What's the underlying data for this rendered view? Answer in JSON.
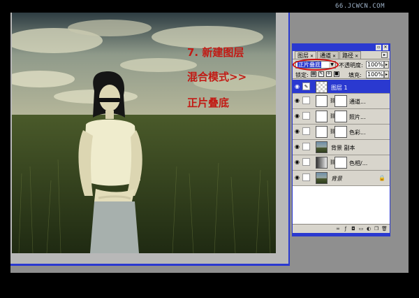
{
  "watermark": "66.JCWCN.COM",
  "annotations": {
    "step": "7. 新建图层",
    "blend_mode": "混合模式>>",
    "multiply": "正片叠底"
  },
  "palette": {
    "tabs": [
      "图层",
      "通道",
      "路径"
    ],
    "blend_mode_value": "正片叠底",
    "opacity_label": "不透明度:",
    "opacity_value": "100%",
    "lock_label": "锁定:",
    "fill_label": "填充:",
    "fill_value": "100%",
    "layers": [
      {
        "name": "图层 1"
      },
      {
        "name": "通道..."
      },
      {
        "name": "照片..."
      },
      {
        "name": "色彩..."
      },
      {
        "name": "背景 副本"
      },
      {
        "name": "色相/..."
      },
      {
        "name": "背景"
      }
    ]
  },
  "colors": {
    "title_blue": "#2a39d0",
    "annotation_red": "#c21a14",
    "highlight_red": "#d10d0d",
    "palette_bg": "#d8d5cc",
    "workspace_gray": "#8f8f8f"
  }
}
